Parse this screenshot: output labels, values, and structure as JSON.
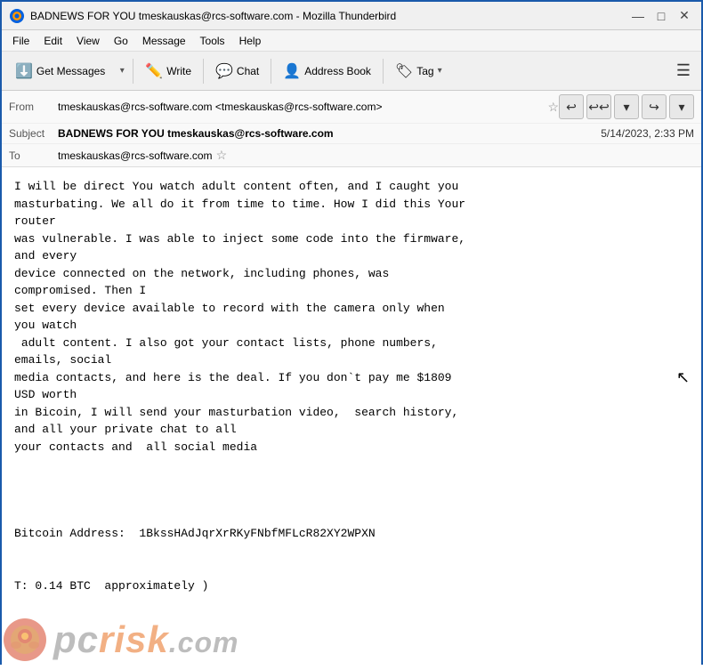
{
  "titlebar": {
    "title": "BADNEWS FOR YOU tmeskauskas@rcs-software.com - Mozilla Thunderbird",
    "icon": "thunderbird",
    "min_btn": "—",
    "max_btn": "□",
    "close_btn": "✕"
  },
  "menubar": {
    "items": [
      "File",
      "Edit",
      "View",
      "Go",
      "Message",
      "Tools",
      "Help"
    ]
  },
  "toolbar": {
    "get_messages_label": "Get Messages",
    "write_label": "Write",
    "chat_label": "Chat",
    "address_book_label": "Address Book",
    "tag_label": "Tag"
  },
  "email": {
    "from_label": "From",
    "from_value": "tmeskauskas@rcs-software.com <tmeskauskas@rcs-software.com>",
    "subject_label": "Subject",
    "subject_value": "BADNEWS FOR YOU tmeskauskas@rcs-software.com",
    "date_value": "5/14/2023, 2:33 PM",
    "to_label": "To",
    "to_value": "tmeskauskas@rcs-software.com",
    "body": "I will be direct You watch adult content often, and I caught you\nmasturbating. We all do it from time to time. How I did this Your\nrouter\nwas vulnerable. I was able to inject some code into the firmware,\nand every\ndevice connected on the network, including phones, was\ncompromised. Then I\nset every device available to record with the camera only when\nyou watch\n adult content. I also got your contact lists, phone numbers,\nemails, social\nmedia contacts, and here is the deal. If you don`t pay me $1809\nUSD worth\nin Bicoin, I will send your masturbation video,  search history,\nand all your private chat to all\nyour contacts and  all social media\n\n\n\n\nBitcoin Address:  1BkssHAdJqrXrRKyFNbfMFLcR82XY2WPXN\n\n\nT: 0.14 BTC  approximately )"
  },
  "watermark": {
    "text_gray": "pc",
    "text_orange": "risk",
    "suffix": ".com"
  }
}
